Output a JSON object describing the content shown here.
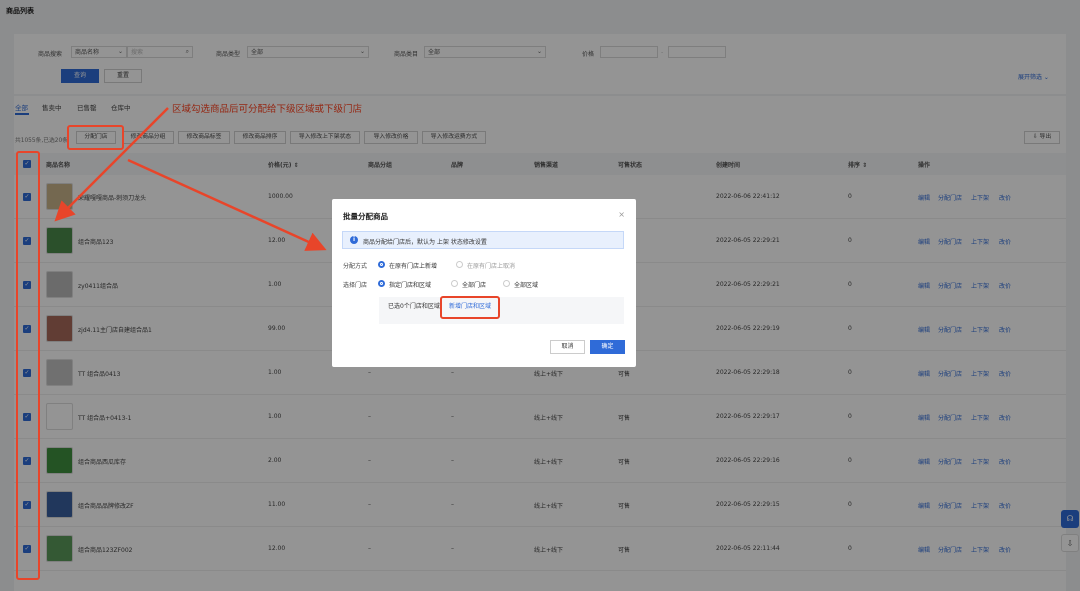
{
  "page_title": "商品列表",
  "filters": {
    "search_label": "商品搜索",
    "search_type": "商品名称",
    "search_placeholder": "搜索",
    "type_label": "商品类型",
    "type_value": "全部",
    "category_label": "商品类目",
    "category_value": "全部",
    "price_label": "价格",
    "price_sep": "-",
    "query_btn": "查询",
    "reset_btn": "重置",
    "expand_label": "展开筛选"
  },
  "tabs": [
    "全部",
    "售卖中",
    "已售罄",
    "仓库中"
  ],
  "annotation": "区域勾选商品后可分配给下级区域或下级门店",
  "selection_info": "共1055条,已选20条",
  "actions": [
    "分配门店",
    "修改商品分组",
    "修改商品标签",
    "修改商品排序",
    "导入修改上下架状态",
    "导入修改价格",
    "导入修改运费方式"
  ],
  "export_label": "导出",
  "columns": [
    "商品名称",
    "价格(元)",
    "商品分组",
    "品牌",
    "销售渠道",
    "可售状态",
    "创建时间",
    "排序",
    "操作"
  ],
  "row_ops": [
    "编辑",
    "分配门店",
    "上下架",
    "改价"
  ],
  "rows": [
    {
      "name": "荣耀嘎嘎商品-刺须刀龙头",
      "price": "1000.00",
      "group": "",
      "brand": "",
      "channel": "",
      "status": "",
      "created": "2022-06-06 22:41:12",
      "sort": "0",
      "thumb_color": "#c9b48a"
    },
    {
      "name": "组合商品123",
      "price": "12.00",
      "group": "",
      "brand": "",
      "channel": "",
      "status": "",
      "created": "2022-06-05 22:29:21",
      "sort": "0",
      "thumb_color": "#4a8a4a"
    },
    {
      "name": "zy0411组合品",
      "price": "1.00",
      "group": "",
      "brand": "",
      "channel": "",
      "status": "",
      "created": "2022-06-05 22:29:21",
      "sort": "0",
      "thumb_color": "#b9b9b9"
    },
    {
      "name": "zjd4.11主门店自建组合品1",
      "price": "99.00",
      "group": "",
      "brand": "",
      "channel": "",
      "status": "",
      "created": "2022-06-05 22:29:19",
      "sort": "0",
      "thumb_color": "#a86a5a"
    },
    {
      "name": "TT 组合品0413",
      "price": "1.00",
      "group": "–",
      "brand": "–",
      "channel": "线上+线下",
      "status": "可售",
      "created": "2022-06-05 22:29:18",
      "sort": "0",
      "thumb_color": "#c2c2c2"
    },
    {
      "name": "TT 组合品+0413-1",
      "price": "1.00",
      "group": "–",
      "brand": "–",
      "channel": "线上+线下",
      "status": "可售",
      "created": "2022-06-05 22:29:17",
      "sort": "0",
      "thumb_color": "#ffffff"
    },
    {
      "name": "组合商品西瓜库存",
      "price": "2.00",
      "group": "–",
      "brand": "–",
      "channel": "线上+线下",
      "status": "可售",
      "created": "2022-06-05 22:29:16",
      "sort": "0",
      "thumb_color": "#3f8f3f"
    },
    {
      "name": "组合商品品牌修改ZF",
      "price": "11.00",
      "group": "–",
      "brand": "–",
      "channel": "线上+线下",
      "status": "可售",
      "created": "2022-06-05 22:29:15",
      "sort": "0",
      "thumb_color": "#3a5f9f"
    },
    {
      "name": "组合商品123ZF002",
      "price": "12.00",
      "group": "–",
      "brand": "–",
      "channel": "线上+线下",
      "status": "可售",
      "created": "2022-06-05 22:11:44",
      "sort": "0",
      "thumb_color": "#5a9a5a"
    }
  ],
  "modal": {
    "title": "批量分配商品",
    "close": "×",
    "info_icon": "i",
    "info": "商品分配给门店后，默认为 上架 状态修改设置",
    "method_label": "分配方式",
    "method_opt1": "在原有门店上新增",
    "method_opt2": "在原有门店上取消",
    "store_label": "选择门店",
    "store_opt1": "指定门店和区域",
    "store_opt2": "全部门店",
    "store_opt3": "全部区域",
    "selected_text": "已选0个门店和区域",
    "add_link": "新增门店和区域",
    "cancel": "取消",
    "ok": "确定"
  },
  "colors": {
    "primary": "#2f6bd8",
    "annotation_red": "#e8452a"
  }
}
